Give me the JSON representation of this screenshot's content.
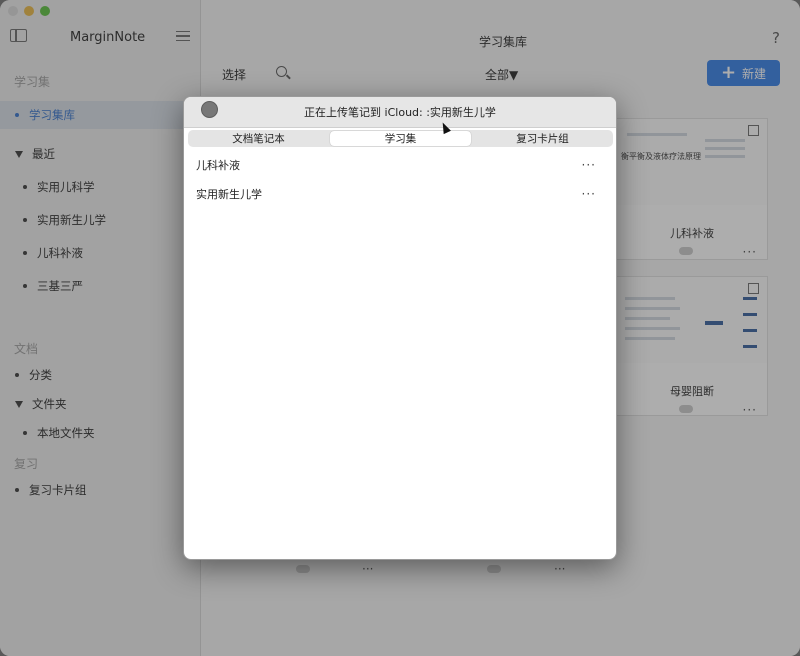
{
  "sidebar": {
    "app_name": "MarginNote",
    "sections": [
      {
        "heading": "学习集",
        "items": [
          {
            "label": "学习集库",
            "selected": true
          }
        ]
      },
      {
        "heading": "最近",
        "collapsible": true,
        "items": [
          {
            "label": "实用儿科学"
          },
          {
            "label": "实用新生儿学"
          },
          {
            "label": "儿科补液"
          },
          {
            "label": "三基三严"
          }
        ]
      },
      {
        "heading": "文档",
        "items": [
          {
            "label": "分类"
          }
        ]
      },
      {
        "heading": "文件夹",
        "collapsible": true,
        "items": [
          {
            "label": "本地文件夹"
          }
        ]
      },
      {
        "heading": "复习",
        "items": [
          {
            "label": "复习卡片组"
          }
        ]
      }
    ]
  },
  "main": {
    "title": "学习集库",
    "help_label": "?",
    "select_label": "选择",
    "filter_label": "全部▼",
    "new_label": "新建",
    "new_plus": "+",
    "cards": [
      {
        "title": "儿科补液",
        "thumb_text": "衡平衡及液体疗法原理",
        "more": "···"
      },
      {
        "title": "母婴阻断",
        "more": "···"
      }
    ],
    "bottom_dots": "···"
  },
  "dialog": {
    "title": "正在上传笔记到 iCloud: :实用新生儿学",
    "tabs": [
      {
        "label": "文档笔记本"
      },
      {
        "label": "学习集",
        "active": true
      },
      {
        "label": "复习卡片组"
      }
    ],
    "rows": [
      {
        "label": "儿科补液",
        "more": "···"
      },
      {
        "label": "实用新生儿学",
        "more": "···"
      }
    ]
  },
  "colors": {
    "accent": "#2e7ae6",
    "selected_bg": "#d6dde6",
    "selected_text": "#2f6fcb"
  },
  "icons": [
    "sidebar-toggle-icon",
    "hamburger-icon",
    "search-icon",
    "help-icon",
    "plus-icon",
    "external-link-icon",
    "cloud-icon",
    "close-icon",
    "more-icon",
    "cursor-icon"
  ]
}
